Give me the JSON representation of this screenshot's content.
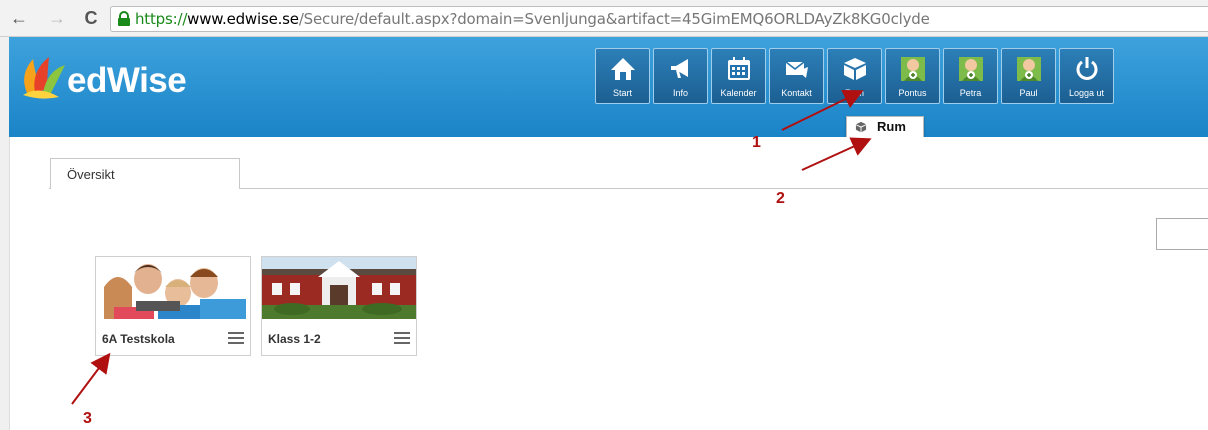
{
  "browser": {
    "url_scheme": "https://",
    "url_host": "www.edwise.se",
    "url_path": "/Secure/default.aspx?domain=Svenljunga&artifact=45GimEMQ6ORLDAyZk8KG0clyde",
    "back_icon": "back-arrow-icon",
    "forward_icon": "forward-arrow-icon",
    "reload_icon": "reload-icon",
    "secure_icon": "padlock-icon"
  },
  "app": {
    "logo_text": "edWise",
    "brand_color": "#2a94d4"
  },
  "toolbar": {
    "items": [
      {
        "label": "Start",
        "icon": "home-icon"
      },
      {
        "label": "Info",
        "icon": "megaphone-icon"
      },
      {
        "label": "Kalender",
        "icon": "calendar-icon"
      },
      {
        "label": "Kontakt",
        "icon": "envelope-icon"
      },
      {
        "label": "Rum",
        "icon": "cube-icon"
      },
      {
        "label": "Pontus",
        "icon": "add-user-icon"
      },
      {
        "label": "Petra",
        "icon": "add-user-icon"
      },
      {
        "label": "Paul",
        "icon": "add-user-icon"
      },
      {
        "label": "Logga ut",
        "icon": "power-icon"
      }
    ],
    "tooltip": "Rum"
  },
  "tabs": [
    {
      "label": "Översikt"
    }
  ],
  "rooms": [
    {
      "title": "6A Testskola",
      "image": "children-at-laptop"
    },
    {
      "title": "Klass 1-2",
      "image": "red-wooden-school-building"
    }
  ],
  "annotations": [
    "1",
    "2",
    "3"
  ],
  "annotation_color": "#b01010"
}
